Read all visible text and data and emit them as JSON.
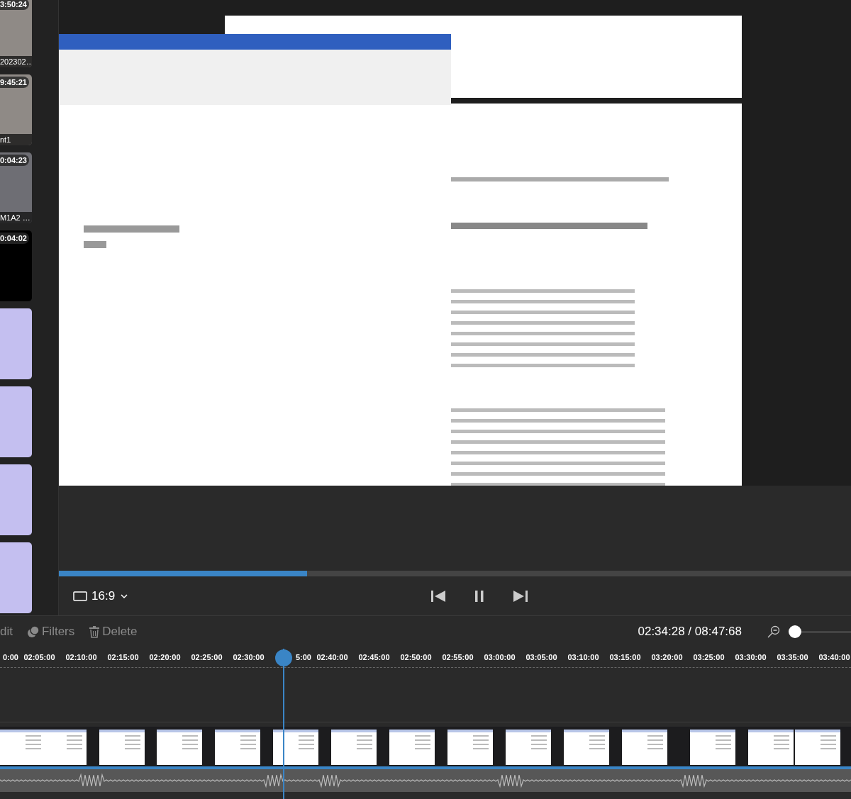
{
  "media_bin": {
    "items": [
      {
        "kind": "indoor",
        "duration": "3:50:24",
        "name": "202302…"
      },
      {
        "kind": "indoor",
        "duration": "9:45:21",
        "name": "nt1"
      },
      {
        "kind": "wall",
        "duration": "0:04:23",
        "name": "M1A2 …"
      },
      {
        "kind": "dark",
        "duration": "0:04:02"
      },
      {
        "kind": "sky"
      },
      {
        "kind": "sky"
      },
      {
        "kind": "sky"
      },
      {
        "kind": "sky"
      }
    ]
  },
  "player": {
    "progress": {
      "level": 0.313
    },
    "aspect": "16:9"
  },
  "toolbar": {
    "actions": [
      {
        "label": "dit",
        "kind": "text"
      },
      {
        "label": "Filters",
        "kind": "filters"
      },
      {
        "label": "Delete",
        "kind": "delete"
      }
    ],
    "time": "02:34:28 / 08:47:68",
    "zoom": {
      "level": 0.0
    }
  },
  "timeline": {
    "ticks": [
      "0:00",
      "02:05:00",
      "02:10:00",
      "02:15:00",
      "02:20:00",
      "02:25:00",
      "02:30:00",
      "5:00",
      "02:40:00",
      "02:45:00",
      "02:50:00",
      "02:55:00",
      "03:00:00",
      "03:05:00",
      "03:10:00",
      "03:15:00",
      "03:20:00",
      "03:25:00",
      "03:30:00",
      "03:35:00",
      "03:40:00"
    ],
    "playhead": {
      "level": 0.333
    }
  }
}
